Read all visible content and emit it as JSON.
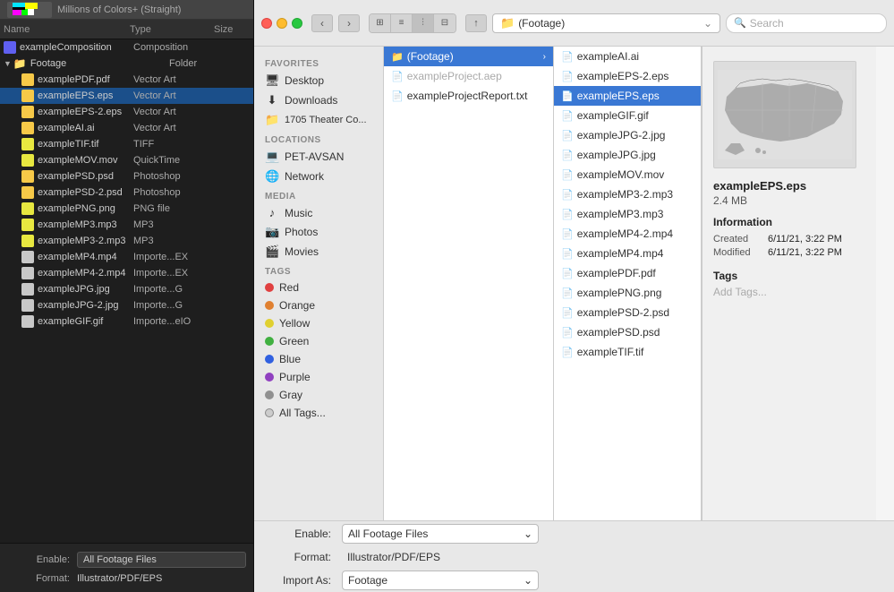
{
  "ae": {
    "topbar_title": "Millions of Colors+ (Straight)",
    "col_name": "Name",
    "col_type": "Type",
    "col_size": "Size",
    "composition": "exampleComposition",
    "composition_type": "Composition",
    "folder": "Footage",
    "folder_type": "Folder",
    "files": [
      {
        "name": "examplePDF.pdf",
        "type": "Vector Art",
        "color": "#f7c948"
      },
      {
        "name": "exampleEPS.eps",
        "type": "Vector Art",
        "color": "#f7c948",
        "selected": true
      },
      {
        "name": "exampleEPS-2.eps",
        "type": "Vector Art",
        "color": "#f7c948"
      },
      {
        "name": "exampleAI.ai",
        "type": "Vector Art",
        "color": "#f7c948"
      },
      {
        "name": "exampleTIF.tif",
        "type": "TIFF",
        "color": "#e8e840"
      },
      {
        "name": "exampleMOV.mov",
        "type": "QuickTime",
        "color": "#e8e840"
      },
      {
        "name": "examplePSD.psd",
        "type": "Photoshop",
        "color": "#f7c948"
      },
      {
        "name": "examplePSD-2.psd",
        "type": "Photoshop",
        "color": "#f7c948"
      },
      {
        "name": "examplePNG.png",
        "type": "PNG file",
        "color": "#e8e840"
      },
      {
        "name": "exampleMP3.mp3",
        "type": "MP3",
        "color": "#e8e840"
      },
      {
        "name": "exampleMP3-2.mp3",
        "type": "MP3",
        "color": "#e8e840"
      },
      {
        "name": "exampleMP4.mp4",
        "type": "Importe...EX",
        "color": "#c8c8c8"
      },
      {
        "name": "exampleMP4-2.mp4",
        "type": "Importe...EX",
        "color": "#c8c8c8"
      },
      {
        "name": "exampleJPG.jpg",
        "type": "Importe...G",
        "color": "#c8c8c8"
      },
      {
        "name": "exampleJPG-2.jpg",
        "type": "Importe...G",
        "color": "#c8c8c8"
      },
      {
        "name": "exampleGIF.gif",
        "type": "Importe...eIO",
        "color": "#c8c8c8"
      }
    ]
  },
  "finder": {
    "nav": {
      "back": "‹",
      "forward": "›"
    },
    "path_label": "(Footage)",
    "search_placeholder": "Search",
    "sidebar": {
      "favorites_label": "Favorites",
      "locations_label": "Locations",
      "media_label": "Media",
      "tags_label": "Tags",
      "favorites": [
        {
          "label": "Desktop",
          "icon": "🖥"
        },
        {
          "label": "Downloads",
          "icon": "⬇"
        },
        {
          "label": "1705 Theater Co...",
          "icon": "📁"
        }
      ],
      "locations": [
        {
          "label": "PET-AVSAN",
          "icon": "💻"
        },
        {
          "label": "Network",
          "icon": "🌐"
        }
      ],
      "media": [
        {
          "label": "Music",
          "icon": "♪"
        },
        {
          "label": "Photos",
          "icon": "📷"
        },
        {
          "label": "Movies",
          "icon": "🎬"
        }
      ],
      "tags": [
        {
          "label": "Red",
          "color": "#e04040"
        },
        {
          "label": "Orange",
          "color": "#e08030"
        },
        {
          "label": "Yellow",
          "color": "#e0d030"
        },
        {
          "label": "Green",
          "color": "#40b040"
        },
        {
          "label": "Blue",
          "color": "#3060e0"
        },
        {
          "label": "Purple",
          "color": "#9040c0"
        },
        {
          "label": "Gray",
          "color": "#909090"
        },
        {
          "label": "All Tags...",
          "color": null
        }
      ]
    },
    "col1": {
      "items": [
        {
          "name": "(Footage)",
          "selected": true,
          "has_arrow": true,
          "icon": "📁",
          "icon_color": "#5b9bd5"
        }
      ],
      "subitems": [
        {
          "name": "exampleProject.aep",
          "icon": "📄",
          "grayed": true
        },
        {
          "name": "exampleProjectReport.txt",
          "icon": "📄",
          "grayed": false
        }
      ]
    },
    "col2": {
      "items": [
        {
          "name": "exampleAI.ai",
          "icon": "📄"
        },
        {
          "name": "exampleEPS-2.eps",
          "icon": "📄"
        },
        {
          "name": "exampleEPS.eps",
          "icon": "📄",
          "selected": true
        },
        {
          "name": "exampleGIF.gif",
          "icon": "📄"
        },
        {
          "name": "exampleJPG-2.jpg",
          "icon": "📄"
        },
        {
          "name": "exampleJPG.jpg",
          "icon": "📄"
        },
        {
          "name": "exampleMOV.mov",
          "icon": "📄"
        },
        {
          "name": "exampleMP3-2.mp3",
          "icon": "📄"
        },
        {
          "name": "exampleMP3.mp3",
          "icon": "📄"
        },
        {
          "name": "exampleMP4-2.mp4",
          "icon": "📄"
        },
        {
          "name": "exampleMP4.mp4",
          "icon": "📄"
        },
        {
          "name": "examplePDF.pdf",
          "icon": "📄"
        },
        {
          "name": "examplePNG.png",
          "icon": "📄"
        },
        {
          "name": "examplePSD-2.psd",
          "icon": "📄"
        },
        {
          "name": "examplePSD.psd",
          "icon": "📄"
        },
        {
          "name": "exampleTIF.tif",
          "icon": "📄"
        }
      ]
    },
    "preview": {
      "filename": "exampleEPS.eps",
      "filesize": "2.4 MB",
      "info_label": "Information",
      "created_label": "Created",
      "created_value": "6/11/21, 3:22 PM",
      "modified_label": "Modified",
      "modified_value": "6/11/21, 3:22 PM",
      "tags_label": "Tags",
      "tags_add": "Add Tags..."
    },
    "footer": {
      "enable_label": "Enable:",
      "enable_value": "All Footage Files",
      "format_label": "Format:",
      "format_value": "Illustrator/PDF/EPS",
      "import_label": "Import As:",
      "import_value": "Footage"
    }
  },
  "bottom_labels": {
    "enable": "Enable:",
    "format": "Format:",
    "import_as": "Import As:"
  }
}
